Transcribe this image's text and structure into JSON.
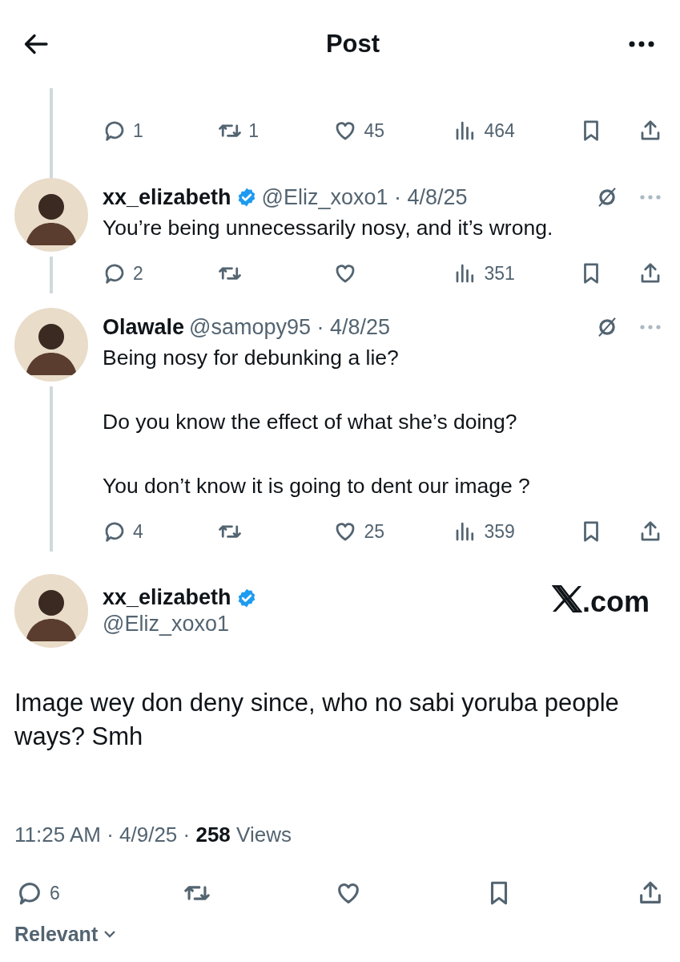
{
  "header": {
    "title": "Post"
  },
  "top_actions": {
    "replies": "1",
    "reposts": "1",
    "likes": "45",
    "views": "464"
  },
  "replies": [
    {
      "author": "xx_elizabeth",
      "verified": true,
      "handle": "@Eliz_xoxo1 · 4/8/25",
      "paragraphs": [
        "You’re being unnecessarily nosy, and it’s wrong."
      ],
      "actions": {
        "replies": "2",
        "views": "351"
      }
    },
    {
      "author": "Olawale",
      "verified": false,
      "handle": "@samopy95 · 4/8/25",
      "paragraphs": [
        "Being nosy for debunking a lie?",
        "Do you know the effect of what she’s doing?",
        "You don’t know it is going to dent our image ?"
      ],
      "actions": {
        "replies": "4",
        "likes": "25",
        "views": "359"
      }
    }
  ],
  "main_post": {
    "author": "xx_elizabeth",
    "verified": true,
    "handle": "@Eliz_xoxo1",
    "site_label": ".com",
    "text": "Image wey don deny since, who no sabi yoruba people ways? Smh",
    "meta": "11:25 AM · 4/9/25 · **258** Views",
    "actions": {
      "replies": "6"
    }
  },
  "section_tab": {
    "label": "Relevant"
  }
}
